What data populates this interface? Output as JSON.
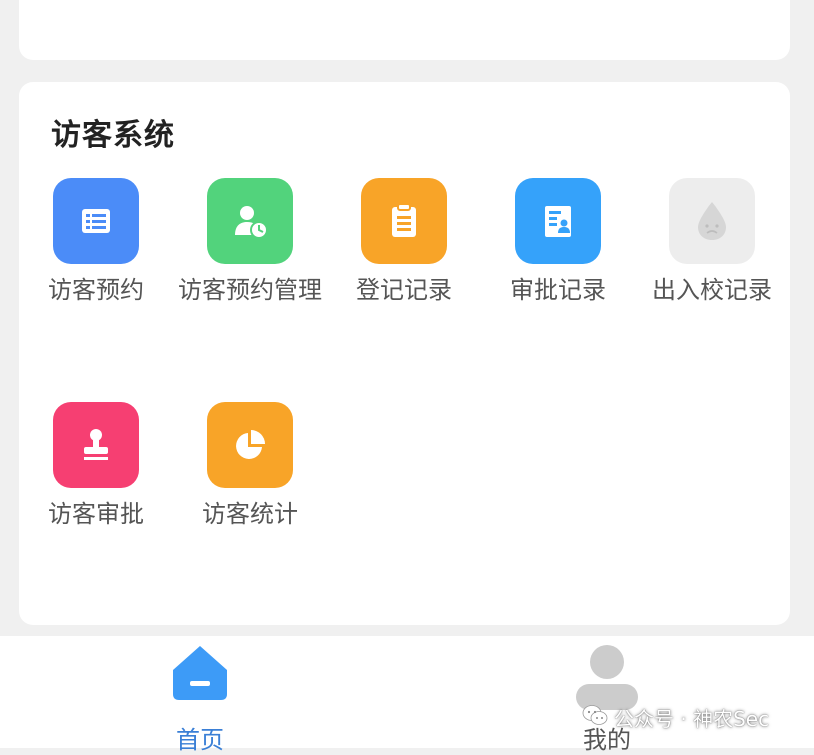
{
  "section": {
    "title": "访客系统",
    "items": [
      {
        "label": "访客预约",
        "icon": "list-icon",
        "color": "#4b8cf8"
      },
      {
        "label": "访客预约管理",
        "icon": "user-clock-icon",
        "color": "#52d37c"
      },
      {
        "label": "登记记录",
        "icon": "clipboard-icon",
        "color": "#f8a428"
      },
      {
        "label": "审批记录",
        "icon": "user-document-icon",
        "color": "#35a2fa"
      },
      {
        "label": "出入校记录",
        "icon": "sad-drop-icon",
        "color": "#ededed"
      },
      {
        "label": "访客审批",
        "icon": "stamp-icon",
        "color": "#f63f72"
      },
      {
        "label": "访客统计",
        "icon": "pie-chart-icon",
        "color": "#f8a428"
      }
    ]
  },
  "tabbar": {
    "home": {
      "label": "首页",
      "icon": "home-icon",
      "color": "#3d9bf7"
    },
    "mine": {
      "label": "我的",
      "icon": "user-icon",
      "color": "#cccccc"
    }
  },
  "watermark": {
    "text": "公众号 · 神农Sec",
    "icon": "wechat-icon"
  }
}
